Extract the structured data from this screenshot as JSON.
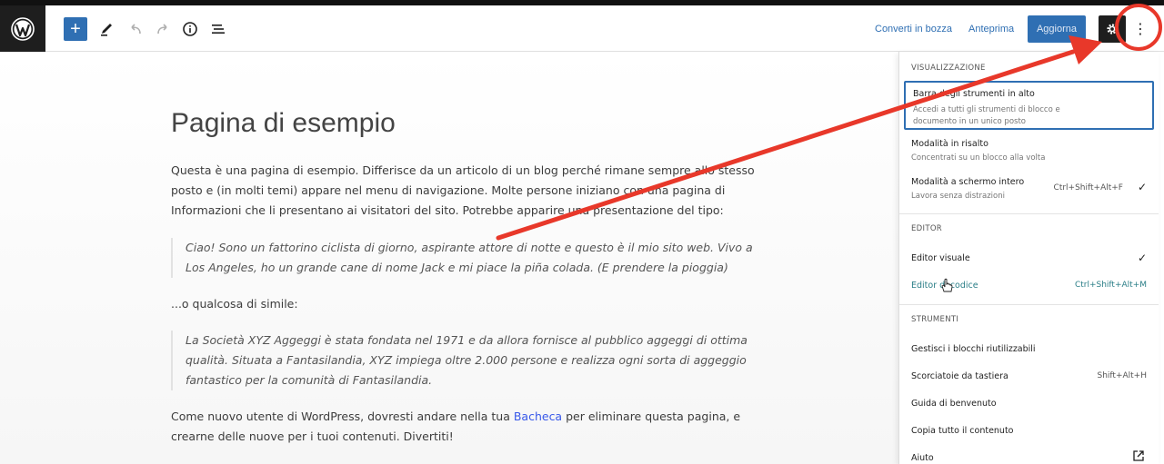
{
  "header": {
    "add_label": "+",
    "converti_label": "Converti in bozza",
    "anteprima_label": "Anteprima",
    "aggiorna_label": "Aggiorna",
    "more_label": "⋮"
  },
  "content": {
    "title": "Pagina di esempio",
    "p1": "Questa è una pagina di esempio. Differisce da un articolo di un blog perché rimane sempre allo stesso posto e (in molti temi) appare nel menu di navigazione. Molte persone iniziano con una pagina di Informazioni che li presentano ai visitatori del sito. Potrebbe apparire una presentazione del tipo:",
    "quote1": "Ciao! Sono un fattorino ciclista di giorno, aspirante attore di notte e questo è il mio sito web. Vivo a Los Angeles, ho un grande cane di nome Jack e mi piace la piña colada. (E prendere la pioggia)",
    "p2": "...o qualcosa di simile:",
    "quote2": "La Società XYZ Aggeggi è stata fondata nel 1971 e da allora fornisce al pubblico aggeggi di ottima qualità. Situata a Fantasilandia, XYZ impiega oltre 2.000 persone e realizza ogni sorta di aggeggio fantastico per la comunità di Fantasilandia.",
    "p3_before": "Come nuovo utente di WordPress, dovresti andare nella tua ",
    "p3_link": "Bacheca",
    "p3_after": " per eliminare questa pagina, e crearne delle nuove per i tuoi contenuti. Divertiti!"
  },
  "menu": {
    "visualizzazione": {
      "heading": "VISUALIZZAZIONE",
      "items": [
        {
          "label": "Barra degli strumenti in alto",
          "desc": "Accedi a tutti gli strumenti di blocco e documento in un unico posto"
        },
        {
          "label": "Modalità in risalto",
          "desc": "Concentrati su un blocco alla volta"
        },
        {
          "label": "Modalità a schermo intero",
          "desc": "Lavora senza distrazioni",
          "shortcut": "Ctrl+Shift+Alt+F",
          "check": "✓"
        }
      ]
    },
    "editor": {
      "heading": "EDITOR",
      "items": [
        {
          "label": "Editor visuale",
          "check": "✓"
        },
        {
          "label": "Editor di codice",
          "shortcut": "Ctrl+Shift+Alt+M"
        }
      ]
    },
    "strumenti": {
      "heading": "STRUMENTI",
      "items": [
        {
          "label": "Gestisci i blocchi riutilizzabili"
        },
        {
          "label": "Scorciatoie da tastiera",
          "shortcut": "Shift+Alt+H"
        },
        {
          "label": "Guida di benvenuto"
        },
        {
          "label": "Copia tutto il contenuto"
        },
        {
          "label": "Aiuto"
        }
      ]
    }
  },
  "colors": {
    "accent": "#2f6fb3",
    "annotation": "#e8382a",
    "teal_link": "#2a7e87"
  },
  "icons": {
    "logo": "wordpress-logo",
    "tools": "pencil-icon",
    "undo": "undo-icon",
    "redo": "redo-icon",
    "info": "info-icon",
    "outline": "list-view-icon",
    "settings": "gear-icon",
    "more": "more-vertical-icon",
    "external": "external-link-icon"
  }
}
